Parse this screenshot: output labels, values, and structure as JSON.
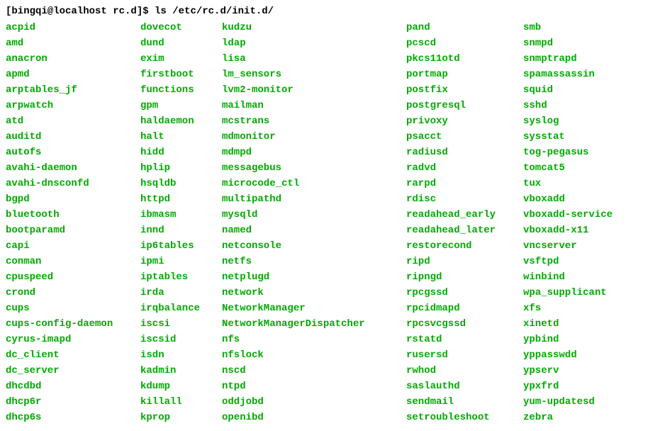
{
  "prompt": "[bingqi@localhost rc.d]$ ls /etc/rc.d/init.d/",
  "columns": {
    "col1": [
      "acpid",
      "amd",
      "anacron",
      "apmd",
      "arptables_jf",
      "arpwatch",
      "atd",
      "auditd",
      "autofs",
      "avahi-daemon",
      "avahi-dnsconfd",
      "bgpd",
      "bluetooth",
      "bootparamd",
      "capi",
      "conman",
      "cpuspeed",
      "crond",
      "cups",
      "cups-config-daemon",
      "cyrus-imapd",
      "dc_client",
      "dc_server",
      "dhcdbd",
      "dhcp6r",
      "dhcp6s"
    ],
    "col2": [
      "dovecot",
      "dund",
      "exim",
      "firstboot",
      "functions",
      "gpm",
      "haldaemon",
      "halt",
      "hidd",
      "hplip",
      "hsqldb",
      "httpd",
      "ibmasm",
      "innd",
      "ip6tables",
      "ipmi",
      "iptables",
      "irda",
      "irqbalance",
      "iscsi",
      "iscsid",
      "isdn",
      "kadmin",
      "kdump",
      "killall",
      "kprop"
    ],
    "col3": [
      "kudzu",
      "ldap",
      "lisa",
      "lm_sensors",
      "lvm2-monitor",
      "mailman",
      "mcstrans",
      "mdmonitor",
      "mdmpd",
      "messagebus",
      "microcode_ctl",
      "multipathd",
      "mysqld",
      "named",
      "netconsole",
      "netfs",
      "netplugd",
      "network",
      "NetworkManager",
      "NetworkManagerDispatcher",
      "nfs",
      "nfslock",
      "nscd",
      "ntpd",
      "oddjobd",
      "openibd"
    ],
    "col4": [
      "pand",
      "pcscd",
      "pkcs11otd",
      "portmap",
      "postfix",
      "postgresql",
      "privoxy",
      "psacct",
      "radiusd",
      "radvd",
      "rarpd",
      "rdisc",
      "readahead_early",
      "readahead_later",
      "restorecond",
      "ripd",
      "ripngd",
      "rpcgssd",
      "rpcidmapd",
      "rpcsvcgssd",
      "rstatd",
      "rusersd",
      "rwhod",
      "saslauthd",
      "sendmail",
      "setroubleshoot"
    ],
    "col5": [
      "smb",
      "snmpd",
      "snmptrapd",
      "spamassassin",
      "squid",
      "sshd",
      "syslog",
      "sysstat",
      "tog-pegasus",
      "tomcat5",
      "tux",
      "vboxadd",
      "vboxadd-service",
      "vboxadd-x11",
      "vncserver",
      "vsftpd",
      "winbind",
      "wpa_supplicant",
      "xfs",
      "xinetd",
      "ypbind",
      "yppasswdd",
      "ypserv",
      "ypxfrd",
      "yum-updatesd",
      "zebra"
    ]
  }
}
